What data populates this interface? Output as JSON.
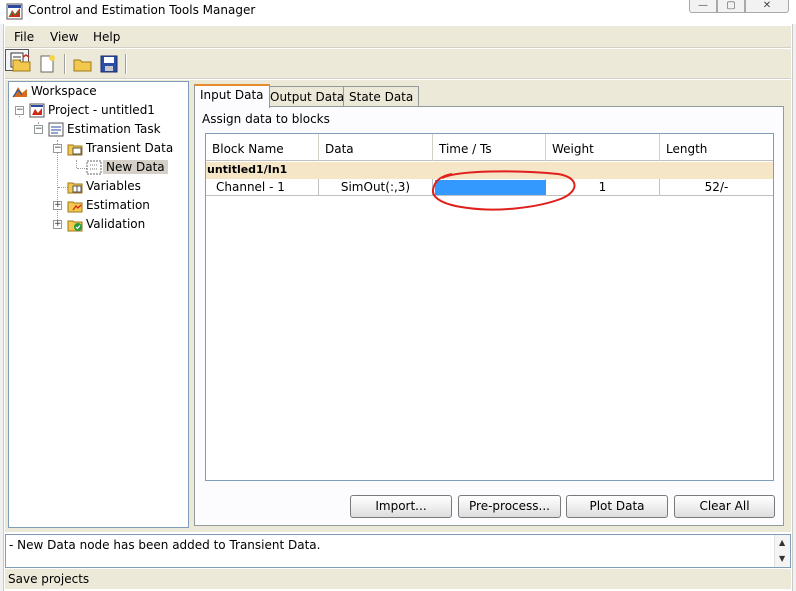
{
  "window": {
    "title": "Control and Estimation Tools Manager",
    "controls": {
      "minimize": "—",
      "maximize": "▢",
      "close": "✕"
    }
  },
  "menubar": {
    "items": [
      "File",
      "View",
      "Help"
    ]
  },
  "toolbar": {
    "icons": [
      "open-folder-icon",
      "new-document-icon",
      "open-icon",
      "save-icon",
      "toggle-message-panel-icon"
    ]
  },
  "tree": {
    "nodes": [
      {
        "label": "Workspace",
        "icon": "workspace-icon"
      },
      {
        "label": "Project - untitled1",
        "icon": "project-icon",
        "expander": "−"
      },
      {
        "label": "Estimation Task",
        "icon": "estimation-task-icon",
        "expander": "−"
      },
      {
        "label": "Transient Data",
        "icon": "transient-data-icon",
        "expander": "−"
      },
      {
        "label": "New Data",
        "icon": "new-data-icon",
        "selected": true
      },
      {
        "label": "Variables",
        "icon": "variables-icon"
      },
      {
        "label": "Estimation",
        "icon": "estimation-icon",
        "expander": "+"
      },
      {
        "label": "Validation",
        "icon": "validation-icon",
        "expander": "+"
      }
    ]
  },
  "tabs": [
    {
      "label": "Input Data",
      "active": true
    },
    {
      "label": "Output Data",
      "active": false
    },
    {
      "label": "State Data",
      "active": false
    }
  ],
  "panel": {
    "title": "Assign data to blocks"
  },
  "table": {
    "columns": [
      "Block Name",
      "Data",
      "Time / Ts",
      "Weight",
      "Length"
    ],
    "group": "untitled1/In1",
    "rows": [
      {
        "block_name": "Channel - 1",
        "data": "SimOut(:,3)",
        "time_ts": "",
        "weight": "1",
        "length": "52/-"
      }
    ],
    "selection_color": "#3399ff",
    "group_color": "#f5e6c8"
  },
  "buttons": {
    "import": "Import...",
    "preprocess": "Pre-process...",
    "plot": "Plot Data",
    "clear": "Clear All"
  },
  "message": {
    "text": "- New Data node has been added to Transient Data."
  },
  "status": {
    "text": "Save projects"
  },
  "colors": {
    "annotation": "#e0201c",
    "tab_highlight": "#e68b2c",
    "chrome": "#ece9d8"
  }
}
